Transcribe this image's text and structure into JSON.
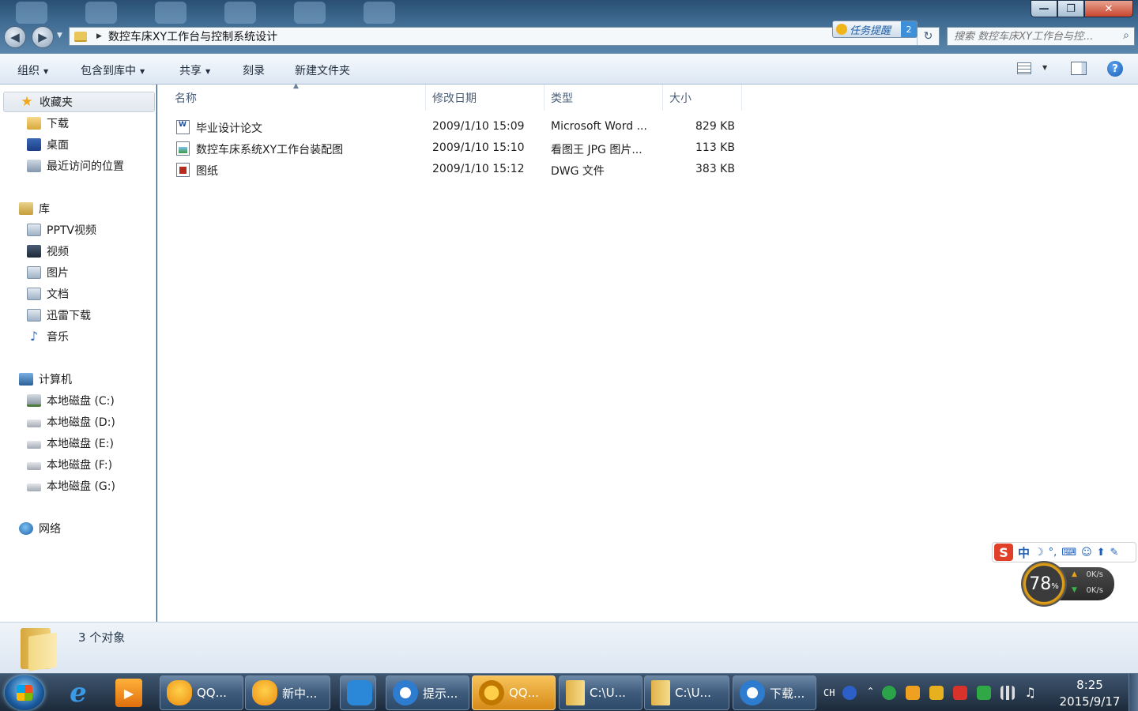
{
  "window": {
    "breadcrumb": "数控车床XY工作台与控制系统设计",
    "search_placeholder": "搜索 数控车床XY工作台与控...",
    "minimize": "—",
    "maximize": "❐",
    "close": "✕",
    "task_reminder": {
      "label": "任务提醒",
      "count": "2"
    }
  },
  "toolbar": {
    "organize": "组织",
    "include_library": "包含到库中",
    "share": "共享",
    "burn": "刻录",
    "new_folder": "新建文件夹"
  },
  "navpane": {
    "favorites": {
      "label": "收藏夹",
      "items": [
        "下载",
        "桌面",
        "最近访问的位置"
      ]
    },
    "libraries": {
      "label": "库",
      "items": [
        "PPTV视频",
        "视频",
        "图片",
        "文档",
        "迅雷下载",
        "音乐"
      ]
    },
    "computer": {
      "label": "计算机",
      "items": [
        "本地磁盘 (C:)",
        "本地磁盘 (D:)",
        "本地磁盘 (E:)",
        "本地磁盘 (F:)",
        "本地磁盘 (G:)"
      ]
    },
    "network": {
      "label": "网络"
    }
  },
  "columns": {
    "name": "名称",
    "date": "修改日期",
    "type": "类型",
    "size": "大小"
  },
  "files": [
    {
      "name": "毕业设计论文",
      "date": "2009/1/10 15:09",
      "type": "Microsoft Word ...",
      "size": "829 KB",
      "icon": "word-doc-icon"
    },
    {
      "name": "数控车床系统XY工作台装配图",
      "date": "2009/1/10 15:10",
      "type": "看图王 JPG 图片...",
      "size": "113 KB",
      "icon": "jpg-image-icon"
    },
    {
      "name": "图纸",
      "date": "2009/1/10 15:12",
      "type": "DWG 文件",
      "size": "383 KB",
      "icon": "dwg-file-icon"
    }
  ],
  "details": {
    "count": "3 个对象"
  },
  "ime": {
    "logo": "S",
    "mode": "中",
    "moon": "☽",
    "punct": "°,",
    "kbd": "⌨",
    "user": "☺",
    "shirt": "⬆",
    "tool": "✎"
  },
  "speed_widget": {
    "percent": "78",
    "percent_sign": "%",
    "up": "0K/s",
    "down": "0K/s"
  },
  "taskbar": {
    "buttons": [
      {
        "label": "QQ...",
        "icon": "qq-icon"
      },
      {
        "label": "新中...",
        "icon": "qq-icon"
      },
      {
        "label": "",
        "icon": "cloud-icon"
      },
      {
        "label": "提示...",
        "icon": "sogou-icon"
      },
      {
        "label": "QQ...",
        "icon": "qq-game-icon"
      },
      {
        "label": "C:\\U...",
        "icon": "folder-icon"
      },
      {
        "label": "C:\\U...",
        "icon": "folder-icon"
      },
      {
        "label": "下载...",
        "icon": "sogou-download-icon"
      }
    ],
    "lang": "CH",
    "time": "8:25",
    "date": "2015/9/17"
  },
  "colors": {
    "accent": "#3c8fd8",
    "taskbar_active": "#f7c35a"
  }
}
